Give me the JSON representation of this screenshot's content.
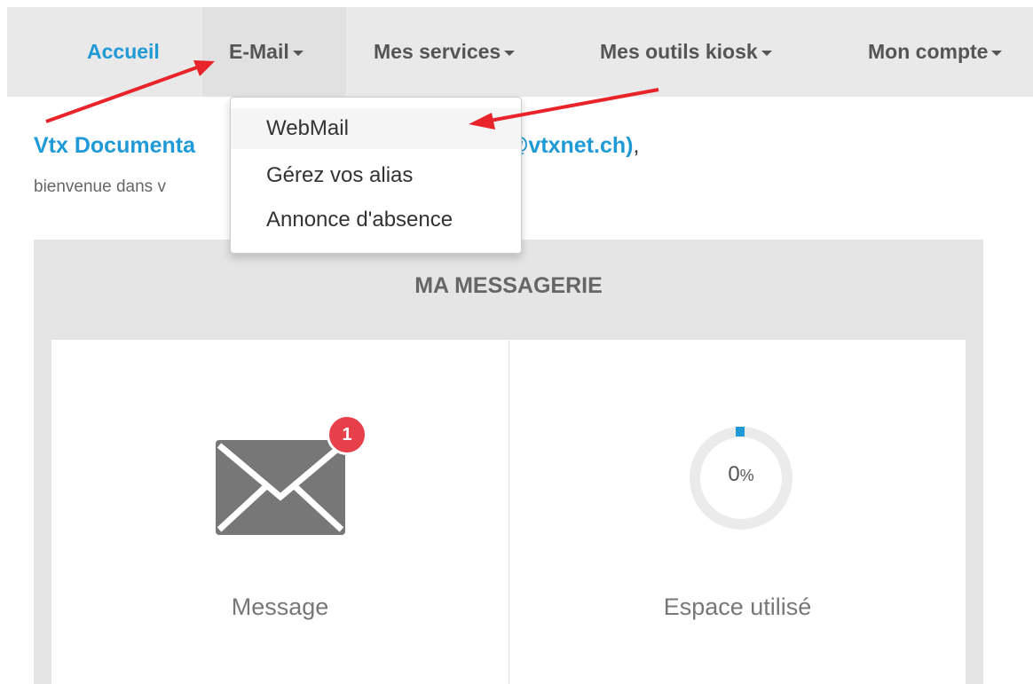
{
  "nav": {
    "items": [
      {
        "label": "Accueil"
      },
      {
        "label": "E-Mail"
      },
      {
        "label": "Mes services"
      },
      {
        "label": "Mes outils kiosk"
      },
      {
        "label": "Mon compte"
      }
    ]
  },
  "dropdown": {
    "items": [
      {
        "label": "WebMail"
      },
      {
        "label": "Gérez vos alias"
      },
      {
        "label": "Annonce d'absence"
      }
    ]
  },
  "welcome": {
    "name_visible": "Vtx Documenta",
    "email_visible": "tation@vtxnet.ch)",
    "punctuation": ",",
    "subtitle_visible": "bienvenue dans v"
  },
  "panel": {
    "title": "MA MESSAGERIE",
    "messages": {
      "badge_count": "1",
      "label": "Message"
    },
    "storage": {
      "value": "0",
      "unit": "%",
      "label": "Espace utilisé",
      "fill_fraction": 0.0
    }
  },
  "colors": {
    "accent": "#1f9ad6",
    "badge": "#e8404b",
    "annotation_arrow": "#e8242a",
    "envelope": "#777777"
  },
  "icons": {
    "envelope": "envelope-icon",
    "caret": "caret-down-icon"
  }
}
